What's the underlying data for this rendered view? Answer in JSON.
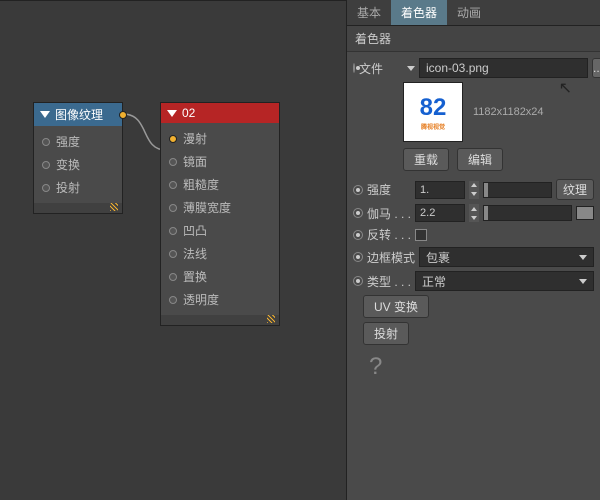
{
  "nodes": {
    "texture": {
      "title": "图像纹理",
      "rows": [
        "强度",
        "变换",
        "投射"
      ]
    },
    "mat": {
      "title": "02",
      "rows": [
        "漫射",
        "镜面",
        "粗糙度",
        "薄膜宽度",
        "凹凸",
        "法线",
        "置换",
        "透明度"
      ]
    }
  },
  "tabs": {
    "basic": "基本",
    "shader": "着色器",
    "anim": "动画"
  },
  "panel": {
    "title": "着色器",
    "fileLabel": "文件",
    "fileValue": "icon-03.png",
    "browse": "...",
    "previewBig": "82",
    "previewSub": "腾视视觉",
    "dims": "1182x1182x24",
    "reload": "重载",
    "edit": "编辑",
    "intensity": "强度",
    "intensityVal": "1.",
    "texBtn": "纹理",
    "gamma": "伽马 . . .",
    "gammaVal": "2.2",
    "invert": "反转 . . .",
    "border": "边框模式",
    "borderVal": "包裹",
    "type": "类型 . . .",
    "typeVal": "正常",
    "uvBtn": "UV 变换",
    "projBtn": "投射",
    "help": "?"
  }
}
